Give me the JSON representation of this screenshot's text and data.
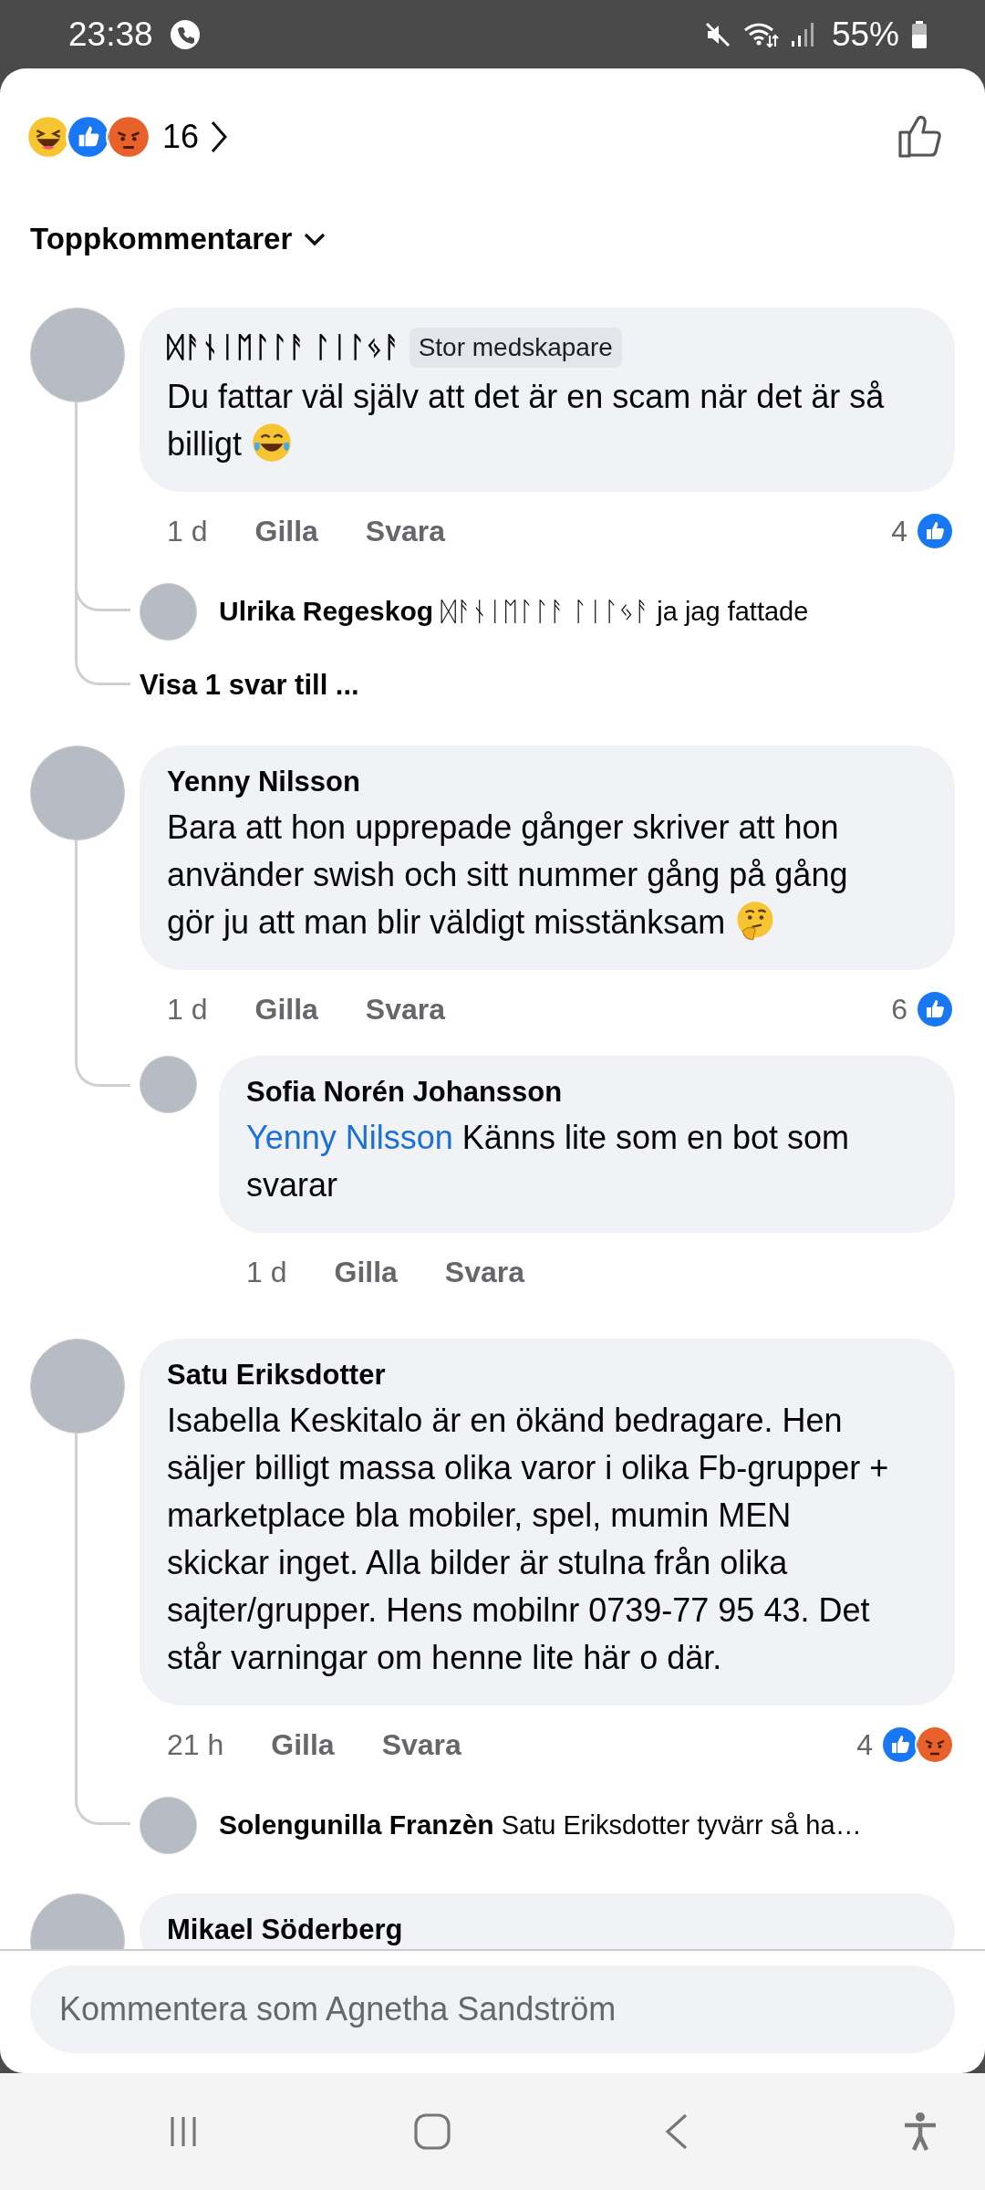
{
  "status_bar": {
    "time": "23:38",
    "battery": "55%"
  },
  "reactions_summary": {
    "reactions": [
      {
        "kind": "haha"
      },
      {
        "kind": "like"
      },
      {
        "kind": "angry"
      }
    ],
    "count": "16"
  },
  "sort": {
    "label": "Toppkommentarer"
  },
  "comments": [
    {
      "author": "ᛞᚨᚾᛁᛖᛚᛚᚨ ᛚᛁᛚᛃᚨ",
      "badge": "Stor medskapare",
      "text": "Du fattar väl själv att det är en scam när det är så billigt",
      "trailing_emoji": {
        "kind": "laugh-cry"
      },
      "time": "1 d",
      "like_label": "Gilla",
      "reply_label": "Svara",
      "reaction_count": "4",
      "reactions": [
        {
          "kind": "like"
        }
      ],
      "replies": [
        {
          "kind": "compact",
          "author": "Ulrika Regeskog",
          "text": "ᛞᚨᚾᛁᛖᛚᛚᚨ ᛚᛁᛚᛃᚨ  ja jag fattade"
        }
      ],
      "more_replies": "Visa 1 svar till ..."
    },
    {
      "author": "Yenny Nilsson",
      "text": "Bara att hon upprepade gånger skriver att hon använder swish och sitt nummer gång på gång gör ju att man blir väldigt misstänksam",
      "trailing_emoji": {
        "kind": "thinking"
      },
      "time": "1 d",
      "like_label": "Gilla",
      "reply_label": "Svara",
      "reaction_count": "6",
      "reactions": [
        {
          "kind": "like"
        }
      ],
      "replies": [
        {
          "kind": "bubble",
          "author": "Sofia Norén Johansson",
          "mention": "Yenny Nilsson",
          "text": "Känns lite som en bot som svarar",
          "time": "1 d",
          "like_label": "Gilla",
          "reply_label": "Svara"
        }
      ]
    },
    {
      "author": "Satu Eriksdotter",
      "text": "Isabella Keskitalo är en ökänd bedragare. Hen säljer billigt massa olika varor i olika Fb-grupper + marketplace bla mobiler, spel, mumin MEN skickar inget. Alla bilder är stulna från olika sajter/grupper. Hens mobilnr 0739-77 95 43. Det står varningar om henne lite här o där.",
      "time": "21 h",
      "like_label": "Gilla",
      "reply_label": "Svara",
      "reaction_count": "4",
      "reactions": [
        {
          "kind": "like"
        },
        {
          "kind": "angry"
        }
      ],
      "replies": [
        {
          "kind": "compact",
          "author": "Solengunilla Franzèn",
          "text": "Satu Eriksdotter tyvärr så ha…"
        }
      ]
    },
    {
      "author": "Mikael Söderberg"
    }
  ],
  "composer": {
    "placeholder": "Kommentera som Agnetha Sandström"
  }
}
